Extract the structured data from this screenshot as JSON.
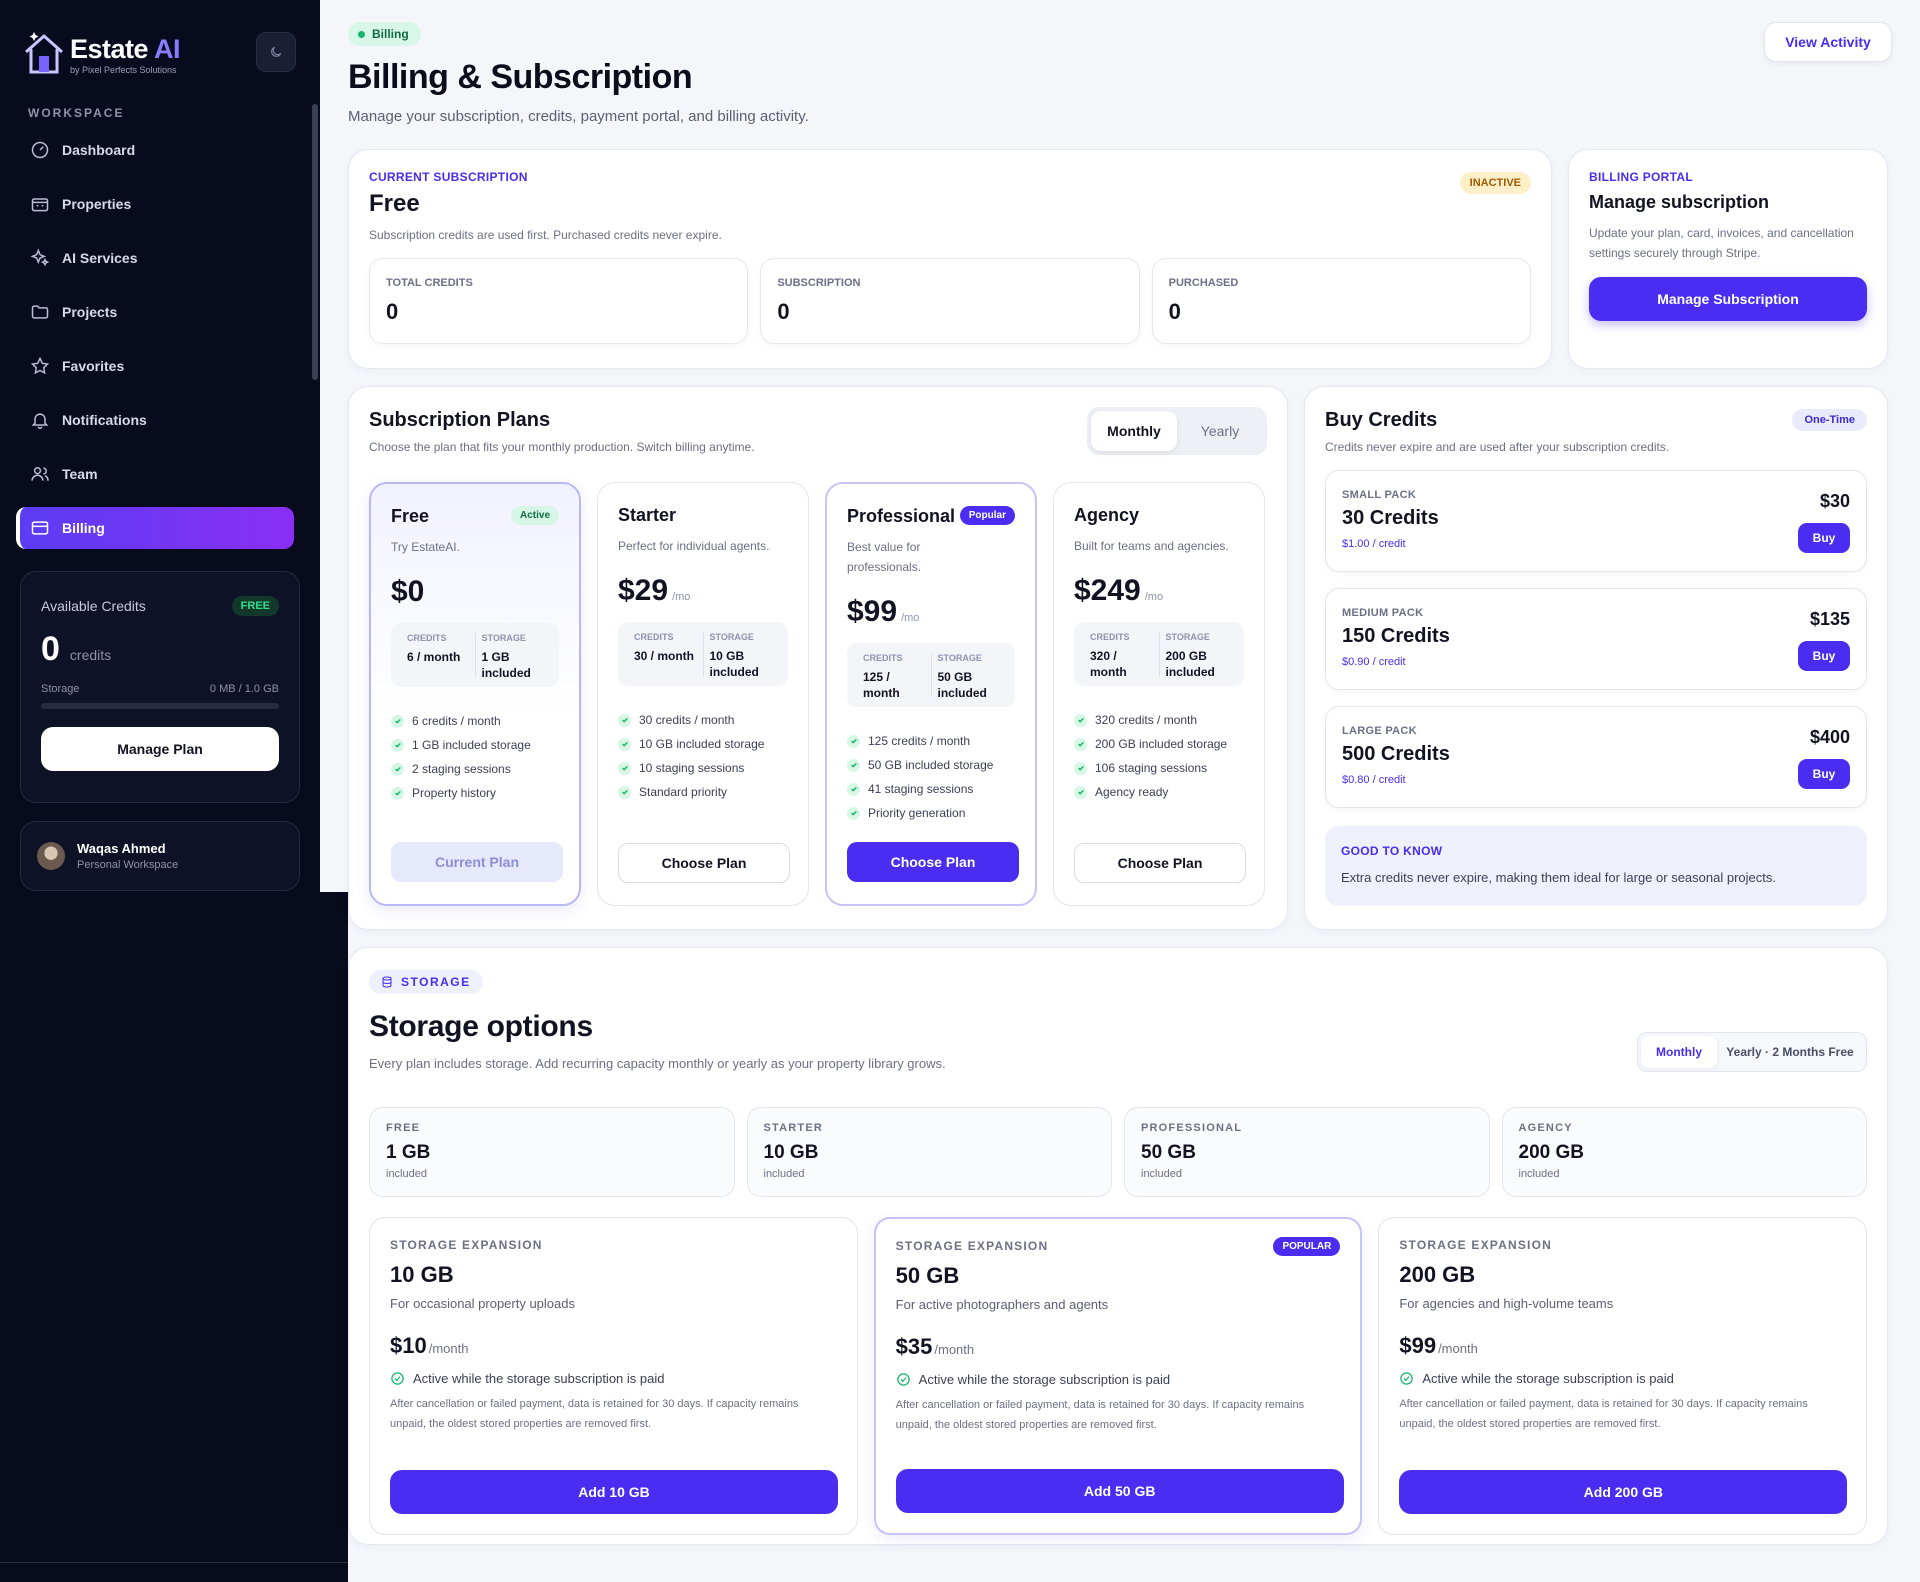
{
  "brand": {
    "name": "Estate",
    "name_accent": "AI",
    "tagline": "by Pixel Perfects Solutions"
  },
  "sidebar": {
    "section_label": "WORKSPACE",
    "items": [
      {
        "label": "Dashboard",
        "icon": "dashboard-gauge-icon"
      },
      {
        "label": "Properties",
        "icon": "building-icon"
      },
      {
        "label": "AI Services",
        "icon": "sparkles-icon"
      },
      {
        "label": "Projects",
        "icon": "folder-icon"
      },
      {
        "label": "Favorites",
        "icon": "star-icon"
      },
      {
        "label": "Notifications",
        "icon": "bell-icon"
      },
      {
        "label": "Team",
        "icon": "users-icon"
      },
      {
        "label": "Billing",
        "icon": "credit-card-icon",
        "active": true
      }
    ],
    "credits": {
      "label": "Available Credits",
      "badge": "FREE",
      "value": "0",
      "unit": "credits",
      "storage_label": "Storage",
      "storage_value": "0 MB / 1.0 GB",
      "storage_fraction": 0,
      "button": "Manage Plan"
    },
    "user": {
      "name": "Waqas Ahmed",
      "workspace": "Personal Workspace"
    }
  },
  "header": {
    "pill": "Billing",
    "title": "Billing & Subscription",
    "subtitle": "Manage your subscription, credits, payment portal, and billing activity.",
    "view_activity": "View Activity"
  },
  "current_subscription": {
    "eyebrow": "CURRENT SUBSCRIPTION",
    "plan": "Free",
    "status": "INACTIVE",
    "note": "Subscription credits are used first. Purchased credits never expire.",
    "stats": [
      {
        "label": "TOTAL CREDITS",
        "value": "0"
      },
      {
        "label": "SUBSCRIPTION",
        "value": "0"
      },
      {
        "label": "PURCHASED",
        "value": "0"
      }
    ]
  },
  "billing_portal": {
    "eyebrow": "BILLING PORTAL",
    "title": "Manage subscription",
    "desc": "Update your plan, card, invoices, and cancellation settings securely through Stripe.",
    "button": "Manage Subscription"
  },
  "plans": {
    "title": "Subscription Plans",
    "desc": "Choose the plan that fits your monthly production. Switch billing anytime.",
    "toggle": {
      "monthly": "Monthly",
      "yearly": "Yearly"
    },
    "credits_key": "CREDITS",
    "storage_key": "STORAGE",
    "items": [
      {
        "name": "Free",
        "badge": "Active",
        "desc": "Try EstateAI.",
        "price": "$0",
        "per": "",
        "credits": "6 / month",
        "storage": "1 GB included",
        "features": [
          "6 credits / month",
          "1 GB included storage",
          "2 staging sessions",
          "Property history"
        ],
        "cta": "Current Plan"
      },
      {
        "name": "Starter",
        "badge": "",
        "desc": "Perfect for individual agents.",
        "price": "$29",
        "per": "/mo",
        "credits": "30 / month",
        "storage": "10 GB included",
        "features": [
          "30 credits / month",
          "10 GB included storage",
          "10 staging sessions",
          "Standard priority"
        ],
        "cta": "Choose Plan"
      },
      {
        "name": "Professional",
        "badge": "Popular",
        "desc": "Best value for professionals.",
        "price": "$99",
        "per": "/mo",
        "credits": "125 / month",
        "storage": "50 GB included",
        "features": [
          "125 credits / month",
          "50 GB included storage",
          "41 staging sessions",
          "Priority generation"
        ],
        "cta": "Choose Plan"
      },
      {
        "name": "Agency",
        "badge": "",
        "desc": "Built for teams and agencies.",
        "price": "$249",
        "per": "/mo",
        "credits": "320 / month",
        "storage": "200 GB included",
        "features": [
          "320 credits / month",
          "200 GB included storage",
          "106 staging sessions",
          "Agency ready"
        ],
        "cta": "Choose Plan"
      }
    ]
  },
  "buy_credits": {
    "title": "Buy Credits",
    "badge": "One-Time",
    "desc": "Credits never expire and are used after your subscription credits.",
    "buy_label": "Buy",
    "packs": [
      {
        "label": "SMALL PACK",
        "title": "30 Credits",
        "per_credit": "$1.00 / credit",
        "price": "$30"
      },
      {
        "label": "MEDIUM PACK",
        "title": "150 Credits",
        "per_credit": "$0.90 / credit",
        "price": "$135"
      },
      {
        "label": "LARGE PACK",
        "title": "500 Credits",
        "per_credit": "$0.80 / credit",
        "price": "$400"
      }
    ],
    "good_to_know": {
      "title": "GOOD TO KNOW",
      "text": "Extra credits never expire, making them ideal for large or seasonal projects."
    }
  },
  "storage": {
    "pill": "STORAGE",
    "title": "Storage options",
    "desc": "Every plan includes storage. Add recurring capacity monthly or yearly as your property library grows.",
    "toggle": {
      "monthly": "Monthly",
      "yearly": "Yearly · 2 Months Free"
    },
    "tiers": [
      {
        "label": "FREE",
        "value": "1 GB",
        "sub": "included"
      },
      {
        "label": "STARTER",
        "value": "10 GB",
        "sub": "included"
      },
      {
        "label": "PROFESSIONAL",
        "value": "50 GB",
        "sub": "included"
      },
      {
        "label": "AGENCY",
        "value": "200 GB",
        "sub": "included"
      }
    ],
    "expansion_label": "STORAGE EXPANSION",
    "active_note": "Active while the storage subscription is paid",
    "fine_print": "After cancellation or failed payment, data is retained for 30 days. If capacity remains unpaid, the oldest stored properties are removed first.",
    "popular_badge": "POPULAR",
    "expansions": [
      {
        "size": "10 GB",
        "desc": "For occasional property uploads",
        "price": "$10",
        "per": "/month",
        "button": "Add 10 GB"
      },
      {
        "size": "50 GB",
        "desc": "For active photographers and agents",
        "price": "$35",
        "per": "/month",
        "button": "Add 50 GB"
      },
      {
        "size": "200 GB",
        "desc": "For agencies and high-volume teams",
        "price": "$99",
        "per": "/month",
        "button": "Add 200 GB"
      }
    ]
  },
  "colors": {
    "accent": "#4b2df2",
    "sidebar_bg": "#070b1d",
    "success": "#12b76a",
    "warning_bg": "#fdf0c8"
  }
}
